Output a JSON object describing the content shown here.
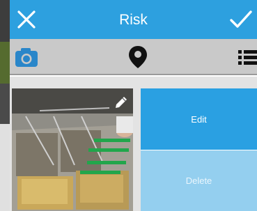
{
  "header": {
    "title": "Risk",
    "background_color": "#2da0df",
    "close_icon": "close-x-icon",
    "confirm_icon": "checkmark-icon"
  },
  "toolbar": {
    "background_color": "#c9c9c9",
    "items": [
      {
        "name": "camera",
        "icon": "camera-icon",
        "color": "#2a86c9"
      },
      {
        "name": "location",
        "icon": "map-pin-icon",
        "color": "#111111"
      },
      {
        "name": "list",
        "icon": "list-icon",
        "color": "#111111"
      }
    ]
  },
  "attachment": {
    "image_description": "photo of industrial fryers with green handles",
    "edit_icon": "pencil-icon"
  },
  "actions": {
    "edit_label": "Edit",
    "delete_label": "Delete",
    "edit_color": "#2aa0e2",
    "delete_color": "#94cfef"
  }
}
